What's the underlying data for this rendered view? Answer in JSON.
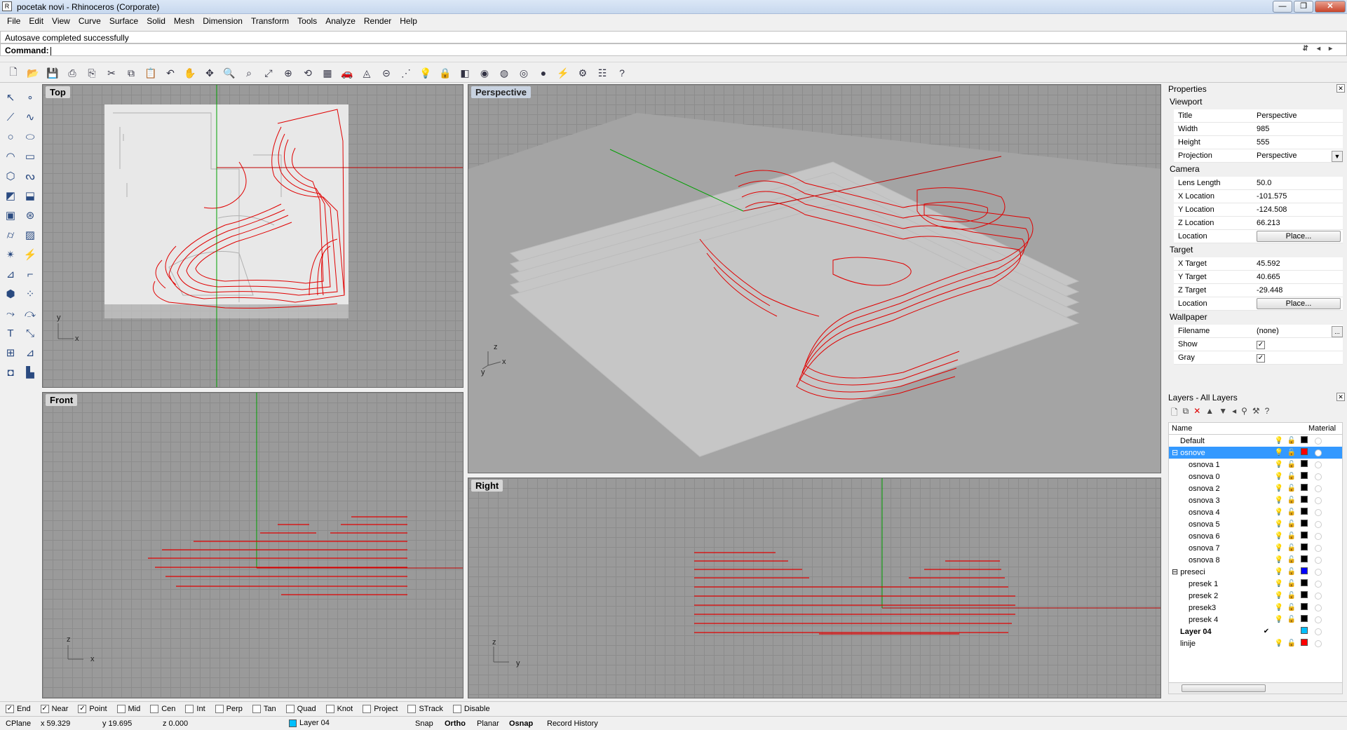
{
  "window": {
    "title": "pocetak novi - Rhinoceros (Corporate)",
    "controls": [
      "—",
      "❐",
      "✕"
    ]
  },
  "menu": [
    "File",
    "Edit",
    "View",
    "Curve",
    "Surface",
    "Solid",
    "Mesh",
    "Dimension",
    "Transform",
    "Tools",
    "Analyze",
    "Render",
    "Help"
  ],
  "command": {
    "history": "Autosave completed successfully",
    "prompt": "Command:"
  },
  "viewports": {
    "top": {
      "label": "Top",
      "axis_x": "x",
      "axis_y": "y"
    },
    "perspective": {
      "label": "Perspective",
      "axis_x": "x",
      "axis_y": "y",
      "axis_z": "z"
    },
    "front": {
      "label": "Front",
      "axis_x": "x",
      "axis_z": "z"
    },
    "right": {
      "label": "Right",
      "axis_y": "y",
      "axis_z": "z"
    }
  },
  "properties": {
    "title": "Properties",
    "section_viewport": "Viewport",
    "title_label": "Title",
    "title_value": "Perspective",
    "width_label": "Width",
    "width_value": "985",
    "height_label": "Height",
    "height_value": "555",
    "projection_label": "Projection",
    "projection_value": "Perspective",
    "section_camera": "Camera",
    "lens_label": "Lens Length",
    "lens_value": "50.0",
    "xloc_label": "X Location",
    "xloc_value": "-101.575",
    "yloc_label": "Y Location",
    "yloc_value": "-124.508",
    "zloc_label": "Z Location",
    "zloc_value": "66.213",
    "location_label": "Location",
    "place_button": "Place...",
    "section_target": "Target",
    "xt_label": "X Target",
    "xt_value": "45.592",
    "yt_label": "Y Target",
    "yt_value": "40.665",
    "zt_label": "Z Target",
    "zt_value": "-29.448",
    "tlocation_label": "Location",
    "tplace_button": "Place...",
    "section_wallpaper": "Wallpaper",
    "filename_label": "Filename",
    "filename_value": "(none)",
    "browse_button": "...",
    "show_label": "Show",
    "gray_label": "Gray"
  },
  "layers": {
    "title": "Layers - All Layers",
    "col_name": "Name",
    "col_material": "Material",
    "current_check": "✔",
    "rows": [
      {
        "name": "Default",
        "indent": 1,
        "color": "#000000",
        "bulb": "#e8d24a"
      },
      {
        "name": "osnove",
        "indent": 0,
        "expander": "⊟",
        "color": "#ff0000",
        "bulb": "#e8d24a",
        "selected": true
      },
      {
        "name": "osnova 1",
        "indent": 2,
        "color": "#000000",
        "bulb": "#e8d24a"
      },
      {
        "name": "osnova 0",
        "indent": 2,
        "color": "#000000",
        "bulb": "#e8d24a"
      },
      {
        "name": "osnova 2",
        "indent": 2,
        "color": "#000000",
        "bulb": "#e8d24a"
      },
      {
        "name": "osnova 3",
        "indent": 2,
        "color": "#000000",
        "bulb": "#e8d24a"
      },
      {
        "name": "osnova 4",
        "indent": 2,
        "color": "#000000",
        "bulb": "#e8d24a"
      },
      {
        "name": "osnova 5",
        "indent": 2,
        "color": "#000000",
        "bulb": "#e8d24a"
      },
      {
        "name": "osnova 6",
        "indent": 2,
        "color": "#000000",
        "bulb": "#e8d24a"
      },
      {
        "name": "osnova 7",
        "indent": 2,
        "color": "#000000",
        "bulb": "#e8d24a"
      },
      {
        "name": "osnova 8",
        "indent": 2,
        "color": "#000000",
        "bulb": "#e8d24a"
      },
      {
        "name": "preseci",
        "indent": 0,
        "expander": "⊟",
        "color": "#0000ff",
        "bulb": "#e8d24a"
      },
      {
        "name": "presek 1",
        "indent": 2,
        "color": "#000000",
        "bulb": "#3a6fb8"
      },
      {
        "name": "presek 2",
        "indent": 2,
        "color": "#000000",
        "bulb": "#3a6fb8"
      },
      {
        "name": "presek3",
        "indent": 2,
        "color": "#000000",
        "bulb": "#3a6fb8"
      },
      {
        "name": "presek 4",
        "indent": 2,
        "color": "#000000",
        "bulb": "#3a6fb8"
      },
      {
        "name": "Layer 04",
        "indent": 1,
        "color": "#00bfff",
        "current": true
      },
      {
        "name": "linije",
        "indent": 1,
        "color": "#ff0000",
        "bulb": "#e8d24a"
      }
    ]
  },
  "osnaps": [
    {
      "label": "End",
      "checked": true
    },
    {
      "label": "Near",
      "checked": true
    },
    {
      "label": "Point",
      "checked": true
    },
    {
      "label": "Mid",
      "checked": false
    },
    {
      "label": "Cen",
      "checked": false
    },
    {
      "label": "Int",
      "checked": false
    },
    {
      "label": "Perp",
      "checked": false
    },
    {
      "label": "Tan",
      "checked": false
    },
    {
      "label": "Quad",
      "checked": false
    },
    {
      "label": "Knot",
      "checked": false
    },
    {
      "label": "Project",
      "checked": false
    },
    {
      "label": "STrack",
      "checked": false
    },
    {
      "label": "Disable",
      "checked": false
    }
  ],
  "status": {
    "cplane": "CPlane",
    "x": "x 59.329",
    "y": "y 19.695",
    "z": "z 0.000",
    "layer": "Layer 04",
    "layer_color": "#00bfff",
    "snap": "Snap",
    "ortho": "Ortho",
    "planar": "Planar",
    "osnap": "Osnap",
    "record": "Record History"
  },
  "colors": {
    "curve": "#e00000",
    "xaxis": "#c00000",
    "yaxis": "#00a000"
  }
}
